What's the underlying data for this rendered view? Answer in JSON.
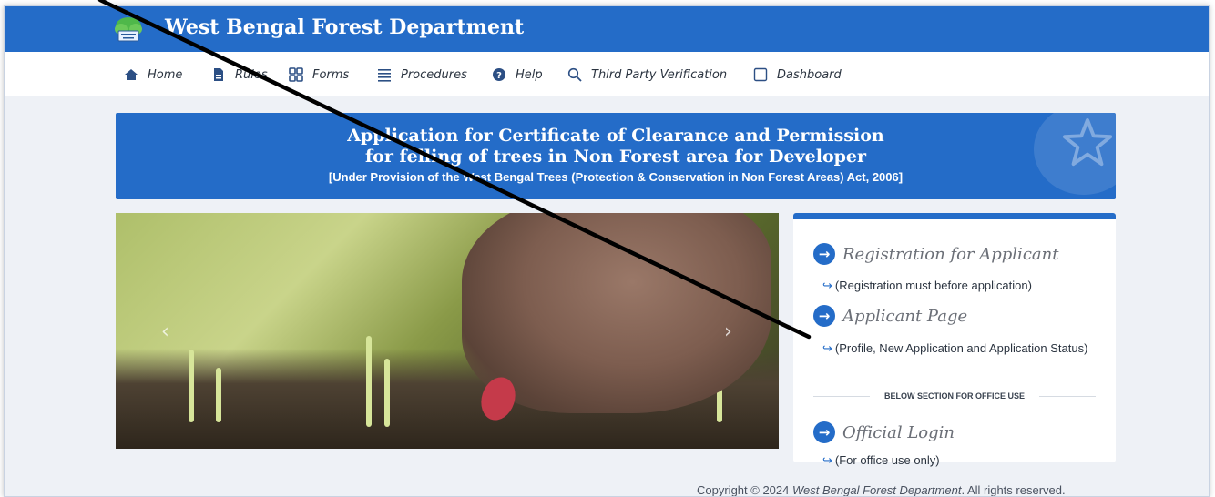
{
  "header": {
    "site_title": "West Bengal Forest Department",
    "brand_color": "#246cc8"
  },
  "nav": {
    "items": [
      {
        "label": "Home",
        "icon": "home-icon"
      },
      {
        "label": "Rules",
        "icon": "document-icon"
      },
      {
        "label": "Forms",
        "icon": "grid-icon"
      },
      {
        "label": "Procedures",
        "icon": "list-icon"
      },
      {
        "label": "Help",
        "icon": "help-icon"
      },
      {
        "label": "Third Party Verification",
        "icon": "search-icon"
      },
      {
        "label": "Dashboard",
        "icon": "square-icon"
      }
    ]
  },
  "banner": {
    "line1": "Application for Certificate of Clearance and Permission",
    "line2": "for felling of trees in Non Forest area for Developer",
    "line3": "[Under Provision of the West Bengal Trees (Protection & Conservation in Non Forest Areas) Act, 2006]",
    "icon": "star-icon"
  },
  "carousel": {
    "prev_glyph": "‹",
    "next_glyph": "›"
  },
  "panel": {
    "registration_title": "Registration for Applicant",
    "registration_note": "(Registration must before application)",
    "applicant_title": "Applicant Page",
    "applicant_note": "(Profile, New Application and Application Status)",
    "divider_text": "BELOW SECTION FOR OFFICE USE",
    "official_title": "Official Login",
    "official_note": "(For office use only)",
    "arrow_glyph": "→",
    "hook_glyph": "↪"
  },
  "footer": {
    "prefix": "Copyright © 2024 ",
    "org": "West Bengal Forest Department",
    "suffix": ". All rights reserved."
  }
}
